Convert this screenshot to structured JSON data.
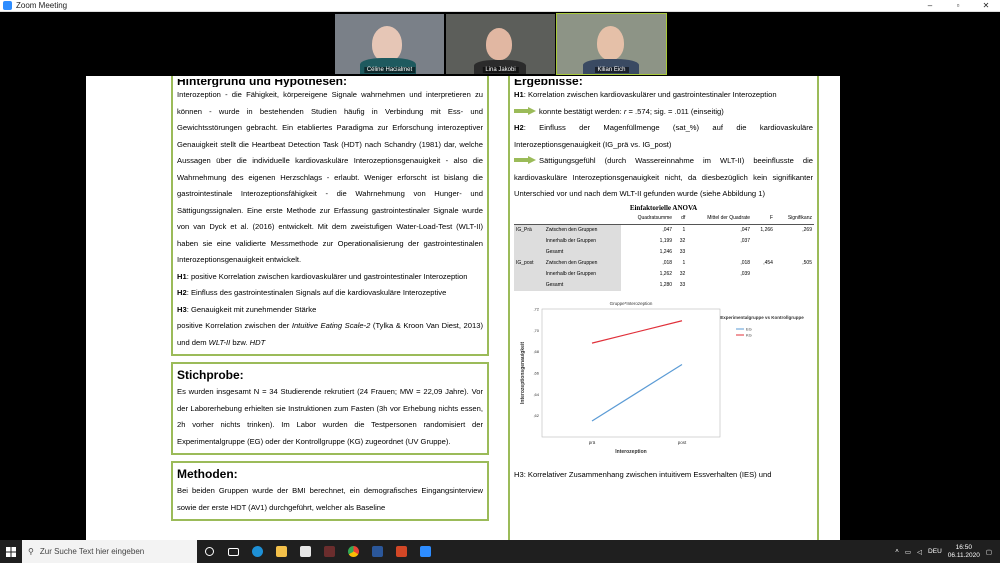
{
  "window": {
    "title": "Zoom Meeting",
    "min": "–",
    "max": "▫",
    "close": "✕"
  },
  "participants": [
    {
      "name": "Céline Hacialmet"
    },
    {
      "name": "Lina Jakobi"
    },
    {
      "name": "Kilian Eich"
    }
  ],
  "left": {
    "header_cropped": "Hintergrund und Hypothesen:",
    "intro": "Interozeption - die Fähigkeit, körpereigene Signale wahrnehmen und interpretieren zu können - wurde in bestehenden Studien häufig in Verbindung mit Ess- und Gewichtsstörungen gebracht. Ein etabliertes Paradigma zur Erforschung interozeptiver Genauigkeit stellt die Heartbeat Detection Task (HDT) nach Schandry (1981) dar, welche Aussagen über die individuelle kardiovaskuläre Interozeptionsgenauigkeit - also die Wahrnehmung des eigenen Herzschlags - erlaubt. Weniger erforscht ist bislang die gastrointestinale Interozeptionsfähigkeit - die Wahrnehmung von Hunger- und Sättigungssignalen. Eine erste Methode zur Erfassung gastrointestinaler Signale wurde von van Dyck et al. (2016) entwickelt. Mit dem zweistufigen Water-Load-Test (WLT-II) haben sie eine validierte Messmethode zur Operationalisierung der gastrointestinalen Interozeptionsgenauigkeit entwickelt.",
    "h1_label": "H1",
    "h1_text": ": positive Korrelation zwischen kardiovaskulärer und gastrointestinaler Interozeption",
    "h2_label": "H2",
    "h2_text": ": Einfluss des gastrointestinalen Signals auf die kardiovaskuläre Interozeptive",
    "h3_label": "H3",
    "h3_text": ": Genauigkeit mit zunehmender Stärke",
    "h3_line2a": "positive Korrelation zwischen der ",
    "h3_line2b": "Intuitive Eating Scale-2",
    "h3_line2c": " (Tylka & Kroon Van Diest, 2013) und dem ",
    "h3_line2d": "WLT-II",
    "h3_line2e": " bzw. ",
    "h3_line2f": "HDT",
    "sample_title": "Stichprobe:",
    "sample_text": "Es wurden insgesamt N = 34 Studierende rekrutiert (24 Frauen; MW = 22,09 Jahre). Vor der Laborerhebung erhielten sie Instruktionen zum Fasten (3h vor Erhebung nichts essen, 2h vorher nichts trinken). Im Labor wurden die Testpersonen randomisiert der Experimentalgruppe (EG) oder der Kontrollgruppe (KG) zugeordnet (UV Gruppe).",
    "methods_title": "Methoden:",
    "methods_text": "Bei beiden Gruppen wurde der BMI berechnet, ein demografisches Eingangsinterview sowie der erste HDT (AV1) durchgeführt, welcher als Baseline"
  },
  "right": {
    "header_cropped": "Ergebnisse:",
    "h1_label": "H1",
    "h1_text": ": Korrelation zwischen kardiovaskulärer und gastrointestinaler Interozeption",
    "h1_result_a": "konnte bestätigt werden: ",
    "h1_result_r": "r",
    "h1_result_b": " = .574; sig. = .011 (einseitig)",
    "h2_label": "H2",
    "h2_text": ": Einfluss der Magenfüllmenge (sat_%) auf die kardiovaskuläre Interozeptionsgenauigkeit (IG_prä vs. IG_post)",
    "h2_result": "Sättigungsgefühl (durch Wassereinnahme im WLT-II) beeinflusste die kardiovaskuläre Interozeptionsgenauigkeit nicht, da diesbezüglich kein signifikanter Unterschied vor und nach dem WLT-II gefunden wurde (siehe Abbildung 1)",
    "bottom_cut": "H3: Korrelativer Zusammenhang zwischen intuitivem Essverhalten (IES) und"
  },
  "anova": {
    "title": "Einfaktorielle ANOVA",
    "headers": [
      "",
      "",
      "Quadratsumme",
      "df",
      "Mittel der Quadrate",
      "F",
      "Signifikanz"
    ],
    "rows": [
      [
        "IG_Prä",
        "Zwischen den Gruppen",
        ",047",
        "1",
        ",047",
        "1,266",
        ",269"
      ],
      [
        "",
        "Innerhalb der Gruppen",
        "1,199",
        "32",
        ",037",
        "",
        ""
      ],
      [
        "",
        "Gesamt",
        "1,246",
        "33",
        "",
        "",
        ""
      ],
      [
        "IG_post",
        "Zwischen den Gruppen",
        ",018",
        "1",
        ",018",
        ",454",
        ",505"
      ],
      [
        "",
        "Innerhalb der Gruppen",
        "1,262",
        "32",
        ",039",
        "",
        ""
      ],
      [
        "",
        "Gesamt",
        "1,280",
        "33",
        "",
        "",
        ""
      ]
    ]
  },
  "colors": {
    "green": "#9bbb59",
    "eg_line": "#5b9bd5",
    "kg_line": "#e0303a"
  },
  "chart_data": {
    "type": "line",
    "title": "Gruppe*Interozeption",
    "xlabel": "Interozeption",
    "ylabel": "Interozeptionsgenauigkeit",
    "categories": [
      "prä",
      "post"
    ],
    "ylim": [
      0.6,
      0.72
    ],
    "yticks": [
      ",62",
      ",64",
      ",66",
      ",68",
      ",70",
      ",72"
    ],
    "legend_title": "Experimentalgruppe vs Kontrollgruppe",
    "legend_position": "top-right",
    "series": [
      {
        "name": "EG",
        "values": [
          0.615,
          0.668
        ],
        "color": "#5b9bd5"
      },
      {
        "name": "KG",
        "values": [
          0.688,
          0.709
        ],
        "color": "#e0303a"
      }
    ]
  },
  "taskbar": {
    "search_placeholder": "Zur Suche Text hier eingeben",
    "lang": "DEU",
    "time": "16:50",
    "date": "06.11.2020"
  }
}
